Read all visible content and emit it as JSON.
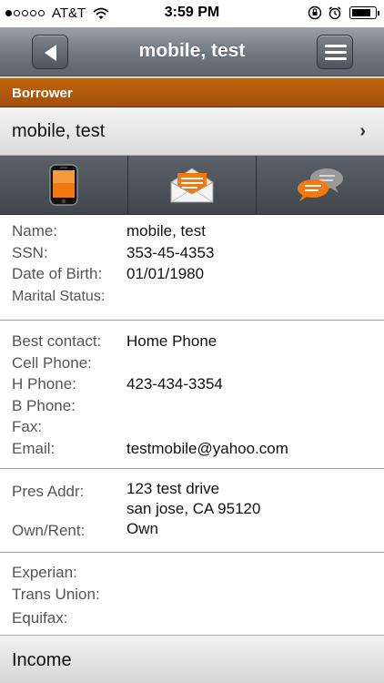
{
  "status_bar": {
    "carrier": "AT&T",
    "time": "3:59 PM",
    "signal_bars_filled": 1,
    "signal_bars_total": 5,
    "battery_level": 0.85
  },
  "nav": {
    "title": "mobile, test",
    "back_icon": "back-arrow-icon",
    "menu_icon": "hamburger-menu-icon"
  },
  "section": {
    "label": "Borrower",
    "color": "#c0650f"
  },
  "borrower_row": {
    "name": "mobile, test",
    "chevron": "›"
  },
  "actions": [
    {
      "icon": "phone-icon"
    },
    {
      "icon": "email-icon"
    },
    {
      "icon": "chat-icon"
    }
  ],
  "personal": {
    "name_label": "Name:",
    "name_value": "mobile, test",
    "ssn_label": "SSN:",
    "ssn_value": "353-45-4353",
    "dob_label": "Date of Birth:",
    "dob_value": "01/01/1980",
    "marital_label": "Marital Status:",
    "marital_value": ""
  },
  "contact": {
    "best_label": "Best contact:",
    "best_value": "Home Phone",
    "cell_label": "Cell Phone:",
    "cell_value": "",
    "hphone_label": "H Phone:",
    "hphone_value": "423-434-3354",
    "bphone_label": "B Phone:",
    "bphone_value": "",
    "fax_label": "Fax:",
    "fax_value": "",
    "email_label": "Email:",
    "email_value": "testmobile@yahoo.com"
  },
  "address": {
    "pres_label": "Pres Addr:",
    "line1": "123 test drive",
    "line2": "san jose, CA  95120",
    "own_label": "Own/Rent:",
    "own_value": "Own"
  },
  "credit": {
    "experian_label": "Experian:",
    "transunion_label": "Trans Union:",
    "equifax_label": "Equifax:"
  },
  "income_row": {
    "label": "Income"
  }
}
